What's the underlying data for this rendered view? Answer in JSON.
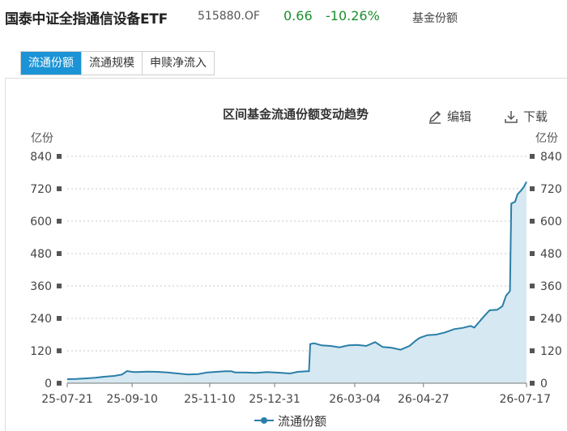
{
  "header": {
    "fund_name": "国泰中证全指通信设备ETF",
    "fund_code": "515880.OF",
    "price": "0.66",
    "change_pct": "-10.26%",
    "tag": "基金份额",
    "price_color": "#1a8f2e"
  },
  "tabs": [
    {
      "label": "流通份额",
      "active": true
    },
    {
      "label": "流通规模",
      "active": false
    },
    {
      "label": "申赎净流入",
      "active": false
    }
  ],
  "tools": {
    "edit_label": "编辑",
    "edit_icon": "pencil-icon",
    "download_label": "下载",
    "download_icon": "download-icon"
  },
  "chart_data": {
    "type": "area",
    "title": "区间基金流通份额变动趋势",
    "ylabel_left": "亿份",
    "ylabel_right": "亿份",
    "ylim": [
      0,
      840
    ],
    "yticks": [
      0,
      120,
      240,
      360,
      480,
      600,
      720,
      840
    ],
    "xtick_labels": [
      "25-07-21",
      "25-09-10",
      "25-11-10",
      "25-12-31",
      "26-03-04",
      "26-04-27",
      "26-07-17"
    ],
    "xtick_positions": [
      "2025-07-21",
      "2025-09-10",
      "2025-11-10",
      "2025-12-31",
      "2026-03-04",
      "2026-04-27",
      "2026-07-17"
    ],
    "grid": true,
    "legend_position": "bottom",
    "line_color": "#2a7ea8",
    "fill_color": "#d6e8f1",
    "series": [
      {
        "name": "流通份额",
        "points": [
          [
            "2025-07-21",
            15
          ],
          [
            "2025-07-28",
            16
          ],
          [
            "2025-08-05",
            18
          ],
          [
            "2025-08-12",
            20
          ],
          [
            "2025-08-19",
            24
          ],
          [
            "2025-08-27",
            27
          ],
          [
            "2025-09-02",
            32
          ],
          [
            "2025-09-06",
            45
          ],
          [
            "2025-09-10",
            42
          ],
          [
            "2025-09-13",
            41
          ],
          [
            "2025-09-22",
            43
          ],
          [
            "2025-09-30",
            42
          ],
          [
            "2025-10-08",
            40
          ],
          [
            "2025-10-16",
            36
          ],
          [
            "2025-10-24",
            32
          ],
          [
            "2025-11-01",
            34
          ],
          [
            "2025-11-08",
            40
          ],
          [
            "2025-11-15",
            42
          ],
          [
            "2025-11-22",
            44
          ],
          [
            "2025-11-27",
            44
          ],
          [
            "2025-11-30",
            40
          ],
          [
            "2025-12-08",
            40
          ],
          [
            "2025-12-16",
            38
          ],
          [
            "2025-12-25",
            41
          ],
          [
            "2025-12-31",
            40
          ],
          [
            "2026-01-06",
            38
          ],
          [
            "2026-01-12",
            36
          ],
          [
            "2026-01-18",
            42
          ],
          [
            "2026-01-25",
            44
          ],
          [
            "2026-01-27",
            44
          ],
          [
            "2026-01-28",
            145
          ],
          [
            "2026-01-31",
            148
          ],
          [
            "2026-02-06",
            140
          ],
          [
            "2026-02-13",
            138
          ],
          [
            "2026-02-20",
            133
          ],
          [
            "2026-02-27",
            140
          ],
          [
            "2026-03-06",
            142
          ],
          [
            "2026-03-13",
            138
          ],
          [
            "2026-03-20",
            152
          ],
          [
            "2026-03-26",
            134
          ],
          [
            "2026-04-02",
            131
          ],
          [
            "2026-04-09",
            124
          ],
          [
            "2026-04-16",
            138
          ],
          [
            "2026-04-21",
            158
          ],
          [
            "2026-04-24",
            168
          ],
          [
            "2026-04-30",
            178
          ],
          [
            "2026-05-07",
            180
          ],
          [
            "2026-05-14",
            188
          ],
          [
            "2026-05-21",
            200
          ],
          [
            "2026-05-28",
            205
          ],
          [
            "2026-06-03",
            212
          ],
          [
            "2026-06-06",
            206
          ],
          [
            "2026-06-10",
            228
          ],
          [
            "2026-06-14",
            250
          ],
          [
            "2026-06-18",
            270
          ],
          [
            "2026-06-24",
            272
          ],
          [
            "2026-06-28",
            285
          ],
          [
            "2026-07-01",
            325
          ],
          [
            "2026-07-03",
            335
          ],
          [
            "2026-07-04",
            342
          ],
          [
            "2026-07-05",
            665
          ],
          [
            "2026-07-08",
            672
          ],
          [
            "2026-07-10",
            700
          ],
          [
            "2026-07-13",
            715
          ],
          [
            "2026-07-15",
            728
          ],
          [
            "2026-07-17",
            746
          ]
        ]
      }
    ]
  }
}
